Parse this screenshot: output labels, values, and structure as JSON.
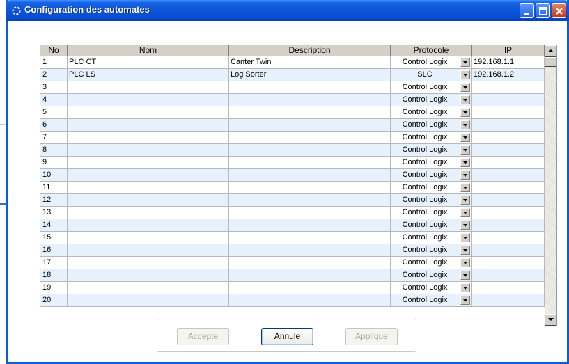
{
  "window": {
    "title": "Configuration des automates"
  },
  "grid": {
    "columns": [
      "No",
      "Nom",
      "Description",
      "Protocole",
      "IP"
    ],
    "rows": [
      {
        "no": "1",
        "nom": "PLC CT",
        "description": "Canter Twin",
        "protocole": "Control Logix",
        "ip": "192.168.1.1"
      },
      {
        "no": "2",
        "nom": "PLC LS",
        "description": "Log Sorter",
        "protocole": "SLC",
        "ip": "192.168.1.2"
      },
      {
        "no": "3",
        "nom": "",
        "description": "",
        "protocole": "Control Logix",
        "ip": ""
      },
      {
        "no": "4",
        "nom": "",
        "description": "",
        "protocole": "Control Logix",
        "ip": ""
      },
      {
        "no": "5",
        "nom": "",
        "description": "",
        "protocole": "Control Logix",
        "ip": ""
      },
      {
        "no": "6",
        "nom": "",
        "description": "",
        "protocole": "Control Logix",
        "ip": ""
      },
      {
        "no": "7",
        "nom": "",
        "description": "",
        "protocole": "Control Logix",
        "ip": ""
      },
      {
        "no": "8",
        "nom": "",
        "description": "",
        "protocole": "Control Logix",
        "ip": ""
      },
      {
        "no": "9",
        "nom": "",
        "description": "",
        "protocole": "Control Logix",
        "ip": ""
      },
      {
        "no": "10",
        "nom": "",
        "description": "",
        "protocole": "Control Logix",
        "ip": ""
      },
      {
        "no": "11",
        "nom": "",
        "description": "",
        "protocole": "Control Logix",
        "ip": ""
      },
      {
        "no": "12",
        "nom": "",
        "description": "",
        "protocole": "Control Logix",
        "ip": ""
      },
      {
        "no": "13",
        "nom": "",
        "description": "",
        "protocole": "Control Logix",
        "ip": ""
      },
      {
        "no": "14",
        "nom": "",
        "description": "",
        "protocole": "Control Logix",
        "ip": ""
      },
      {
        "no": "15",
        "nom": "",
        "description": "",
        "protocole": "Control Logix",
        "ip": ""
      },
      {
        "no": "16",
        "nom": "",
        "description": "",
        "protocole": "Control Logix",
        "ip": ""
      },
      {
        "no": "17",
        "nom": "",
        "description": "",
        "protocole": "Control Logix",
        "ip": ""
      },
      {
        "no": "18",
        "nom": "",
        "description": "",
        "protocole": "Control Logix",
        "ip": ""
      },
      {
        "no": "19",
        "nom": "",
        "description": "",
        "protocole": "Control Logix",
        "ip": ""
      },
      {
        "no": "20",
        "nom": "",
        "description": "",
        "protocole": "Control Logix",
        "ip": ""
      }
    ]
  },
  "buttons": {
    "accept": "Accepte",
    "cancel": "Annule",
    "apply": "Applique"
  },
  "colors": {
    "title_bar": "#0a54d8",
    "row_alt": "#e6f1fb",
    "close_button": "#c5361a"
  }
}
